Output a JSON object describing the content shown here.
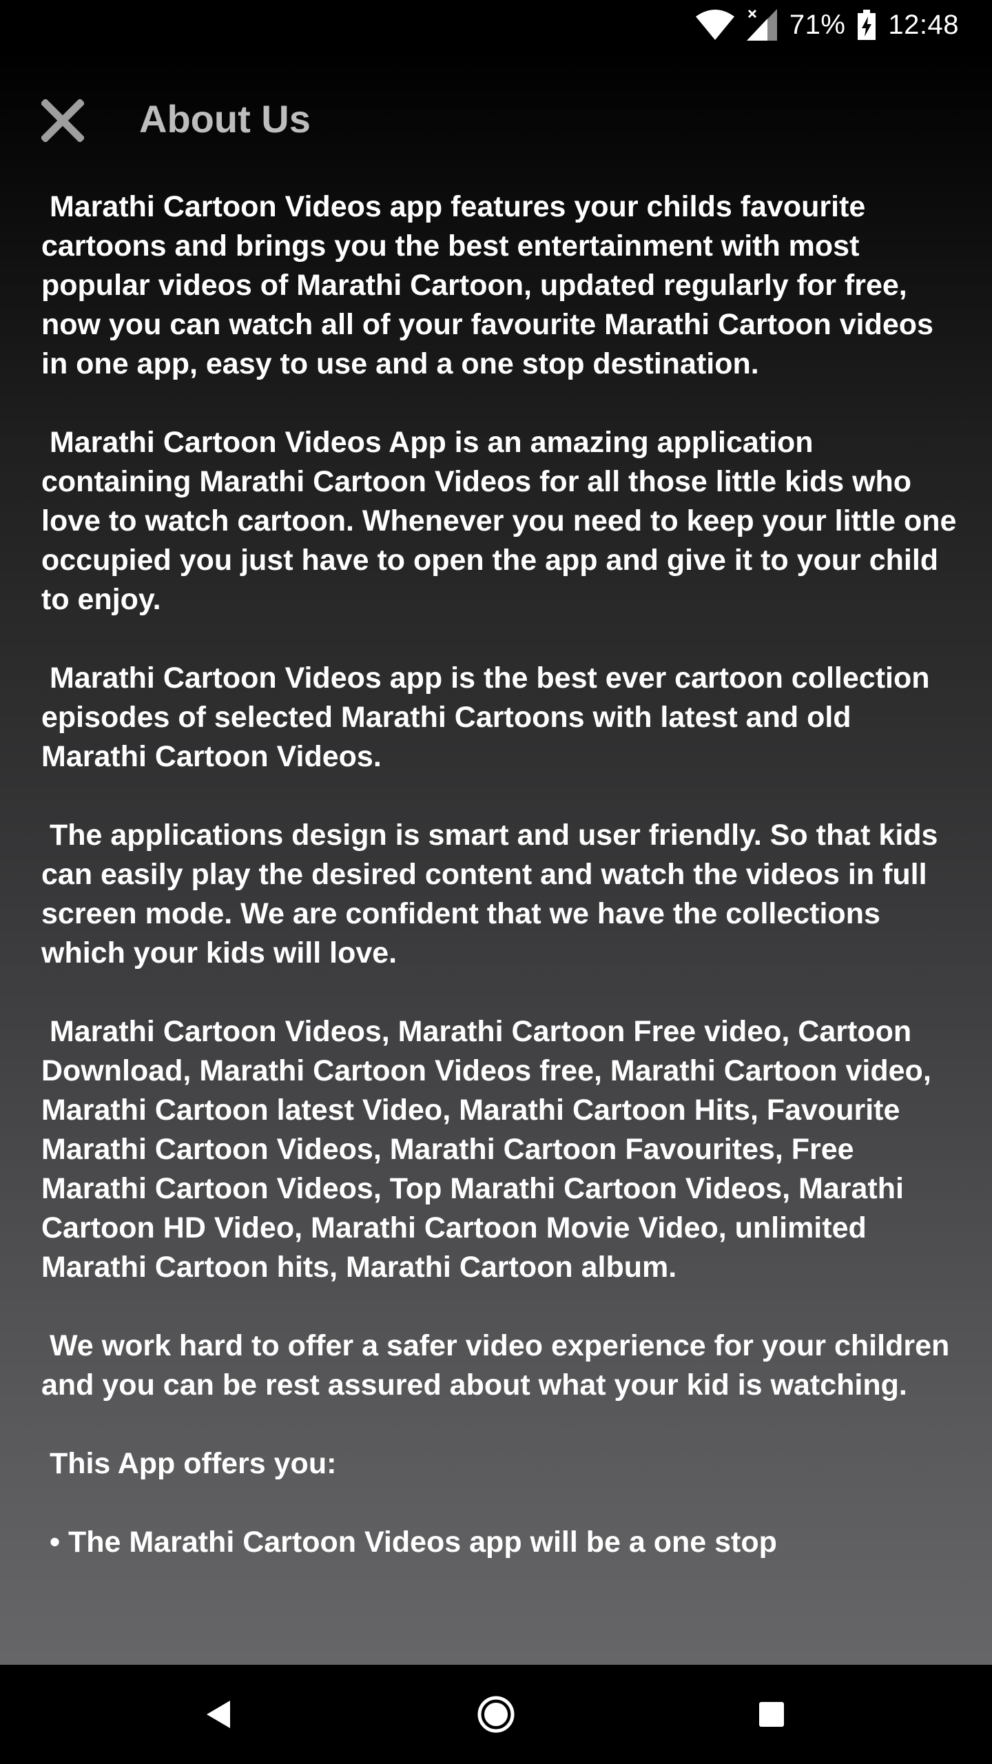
{
  "status_bar": {
    "battery_percent": "71%",
    "time": "12:48",
    "icons": [
      "wifi-icon",
      "signal-icon",
      "battery-charging-icon"
    ]
  },
  "header": {
    "close_icon": "close-icon",
    "title": "About Us"
  },
  "about": {
    "paragraphs": [
      " Marathi Cartoon Videos app features your childs favourite cartoons and brings you the best entertainment with most popular videos of Marathi Cartoon, updated regularly for free, now you can watch all of your favourite Marathi Cartoon videos in one app, easy to use and a one stop destination.",
      " Marathi Cartoon Videos App is an amazing application containing Marathi Cartoon Videos for all those little kids who love to watch cartoon. Whenever you need to keep your little one occupied you just have to open the app and give it to your child to enjoy.",
      " Marathi Cartoon Videos app is the best ever cartoon collection episodes of selected Marathi Cartoons with latest and old Marathi Cartoon Videos.",
      " The applications design is smart and user friendly. So that kids can easily play the desired content and watch the videos in full screen mode. We are confident that we have the collections which your kids will love.",
      " Marathi Cartoon Videos, Marathi Cartoon Free video, Cartoon Download, Marathi Cartoon Videos free, Marathi Cartoon video, Marathi Cartoon latest Video, Marathi Cartoon Hits, Favourite Marathi Cartoon Videos, Marathi Cartoon Favourites, Free Marathi Cartoon Videos, Top Marathi Cartoon Videos, Marathi Cartoon HD Video, Marathi Cartoon Movie Video, unlimited Marathi Cartoon hits, Marathi Cartoon album.",
      " We work hard to offer a safer video experience for your children and you can be rest assured about what your kid is watching.",
      " This App offers you:",
      " • The Marathi Cartoon Videos app will be a one stop"
    ]
  },
  "nav_bar": {
    "icons": [
      "back-icon",
      "home-icon",
      "recents-icon"
    ]
  }
}
